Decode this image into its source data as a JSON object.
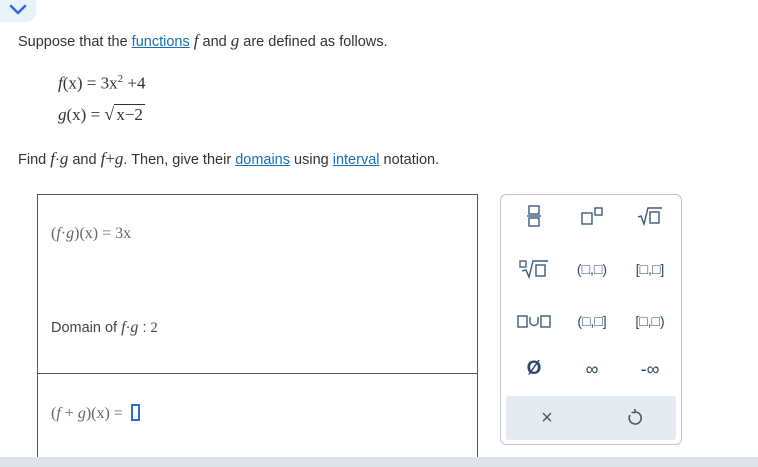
{
  "prompt": {
    "before": "Suppose that the ",
    "link": "functions",
    "f": "f",
    "and": " and ",
    "g": "g",
    "after": " are defined as follows."
  },
  "definitions": {
    "f_lhs": "f",
    "f_rest": "(x) = 3x",
    "f_exp": "2",
    "f_tail": " +4",
    "g_lhs": "g",
    "g_rest": "(x) = ",
    "g_radicand": "x−2"
  },
  "find": {
    "lead": "Find ",
    "expr1_f": "f",
    "expr1_op": "·",
    "expr1_g": "g",
    "mid": " and ",
    "expr2_f": "f",
    "expr2_op": "+",
    "expr2_g": "g",
    "then": ". Then, give their ",
    "link1": "domains",
    "using": " using ",
    "link2": "interval",
    "end": " notation."
  },
  "answers": {
    "product_lhs_open": "(",
    "product_f": "f",
    "product_dot": "·",
    "product_g": "g",
    "product_lhs_close": ")(x) = ",
    "product_value": "3x",
    "domain_label": "Domain of ",
    "domain_f": "f",
    "domain_dot": "·",
    "domain_g": "g",
    "domain_sep": " : ",
    "domain_value": "2",
    "sum_open": "(",
    "sum_f": "f",
    "sum_plus": " + ",
    "sum_g": "g",
    "sum_close": ")(x) = "
  },
  "palette": {
    "open_open": "(□,□)",
    "closed_closed": "[□,□]",
    "open_closed": "(□,□]",
    "closed_open": "[□,□)",
    "empty_set": "Ø",
    "infinity": "∞",
    "neg_infinity": "-∞",
    "clear": "×"
  },
  "colors": {
    "link": "#1a6fb3",
    "cursor": "#2a6ee0",
    "palette_bottom": "#e4eaf0"
  }
}
